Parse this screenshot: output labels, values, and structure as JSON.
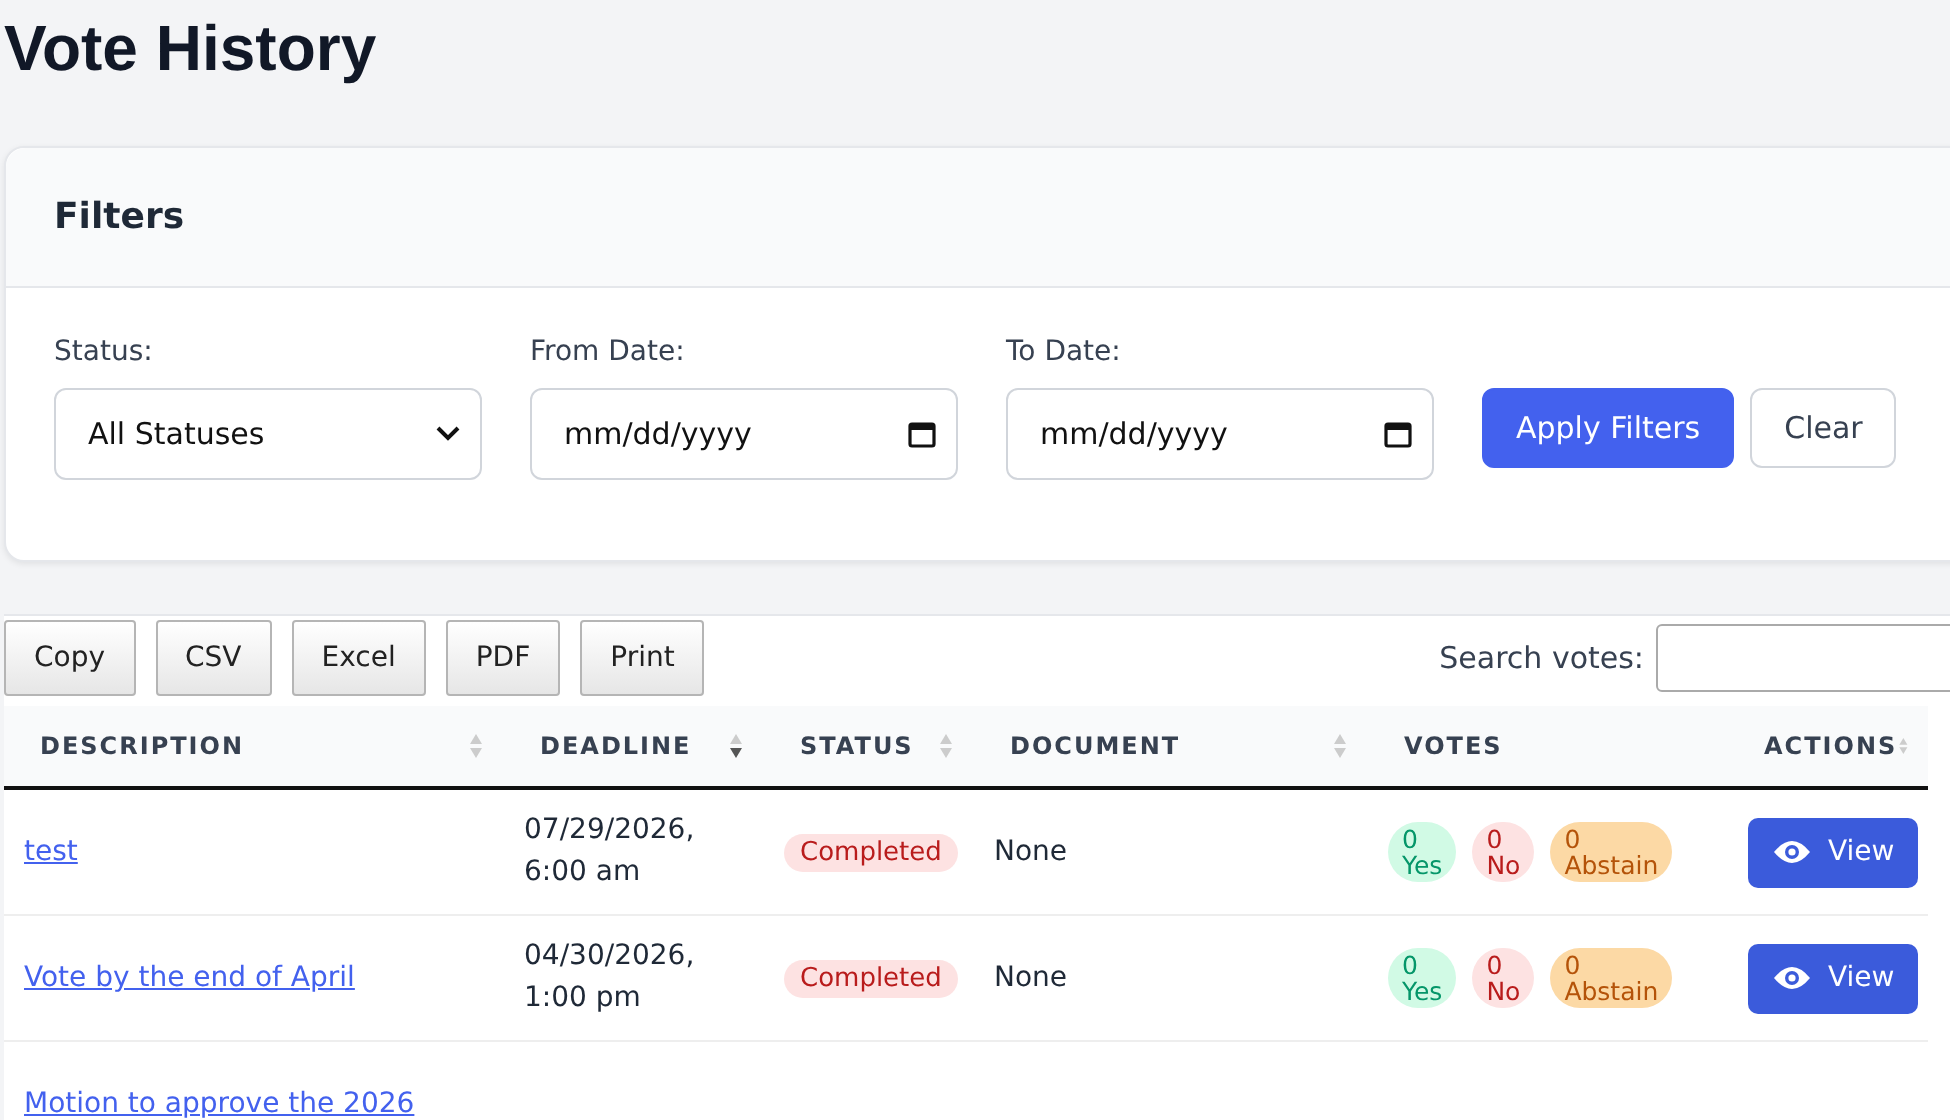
{
  "title": "Vote History",
  "filters": {
    "heading": "Filters",
    "fields": [
      {
        "kind": "select",
        "label": "Status:",
        "value": "All Statuses"
      },
      {
        "kind": "date",
        "label": "From Date:",
        "placeholder": "mm/dd/yyyy"
      },
      {
        "kind": "date",
        "label": "To Date:",
        "placeholder": "mm/dd/yyyy"
      }
    ],
    "buttons": [
      {
        "label": "Apply Filters",
        "kind": "primary"
      },
      {
        "label": "Clear",
        "kind": "secondary"
      }
    ]
  },
  "export_buttons": [
    "Copy",
    "CSV",
    "Excel",
    "PDF",
    "Print"
  ],
  "search": {
    "label": "Search votes:"
  },
  "table": {
    "columns": [
      {
        "label": "DESCRIPTION",
        "sortable": true,
        "sorted_descending": false
      },
      {
        "label": "DEADLINE",
        "sortable": true,
        "sorted_descending": true
      },
      {
        "label": "STATUS",
        "sortable": true,
        "sorted_descending": false
      },
      {
        "label": "DOCUMENT",
        "sortable": true,
        "sorted_descending": false
      },
      {
        "label": "VOTES",
        "sortable": false
      },
      {
        "label": "ACTIONS",
        "sortable": true,
        "sorted_descending": false
      }
    ],
    "rows": [
      {
        "description": "test",
        "deadline": [
          "07/29/2026,",
          "6:00 am"
        ],
        "status": "Completed",
        "document": "None",
        "votes": [
          {
            "kind": "yes",
            "count": "0",
            "label": "Yes"
          },
          {
            "kind": "no",
            "count": "0",
            "label": "No"
          },
          {
            "kind": "abstain",
            "count": "0",
            "label": "Abstain"
          }
        ],
        "action": "View"
      },
      {
        "description": "Vote by the end of April",
        "deadline": [
          "04/30/2026,",
          "1:00 pm"
        ],
        "status": "Completed",
        "document": "None",
        "votes": [
          {
            "kind": "yes",
            "count": "0",
            "label": "Yes"
          },
          {
            "kind": "no",
            "count": "0",
            "label": "No"
          },
          {
            "kind": "abstain",
            "count": "0",
            "label": "Abstain"
          }
        ],
        "action": "View"
      },
      {
        "description": "Motion to approve the 2026"
      }
    ]
  }
}
